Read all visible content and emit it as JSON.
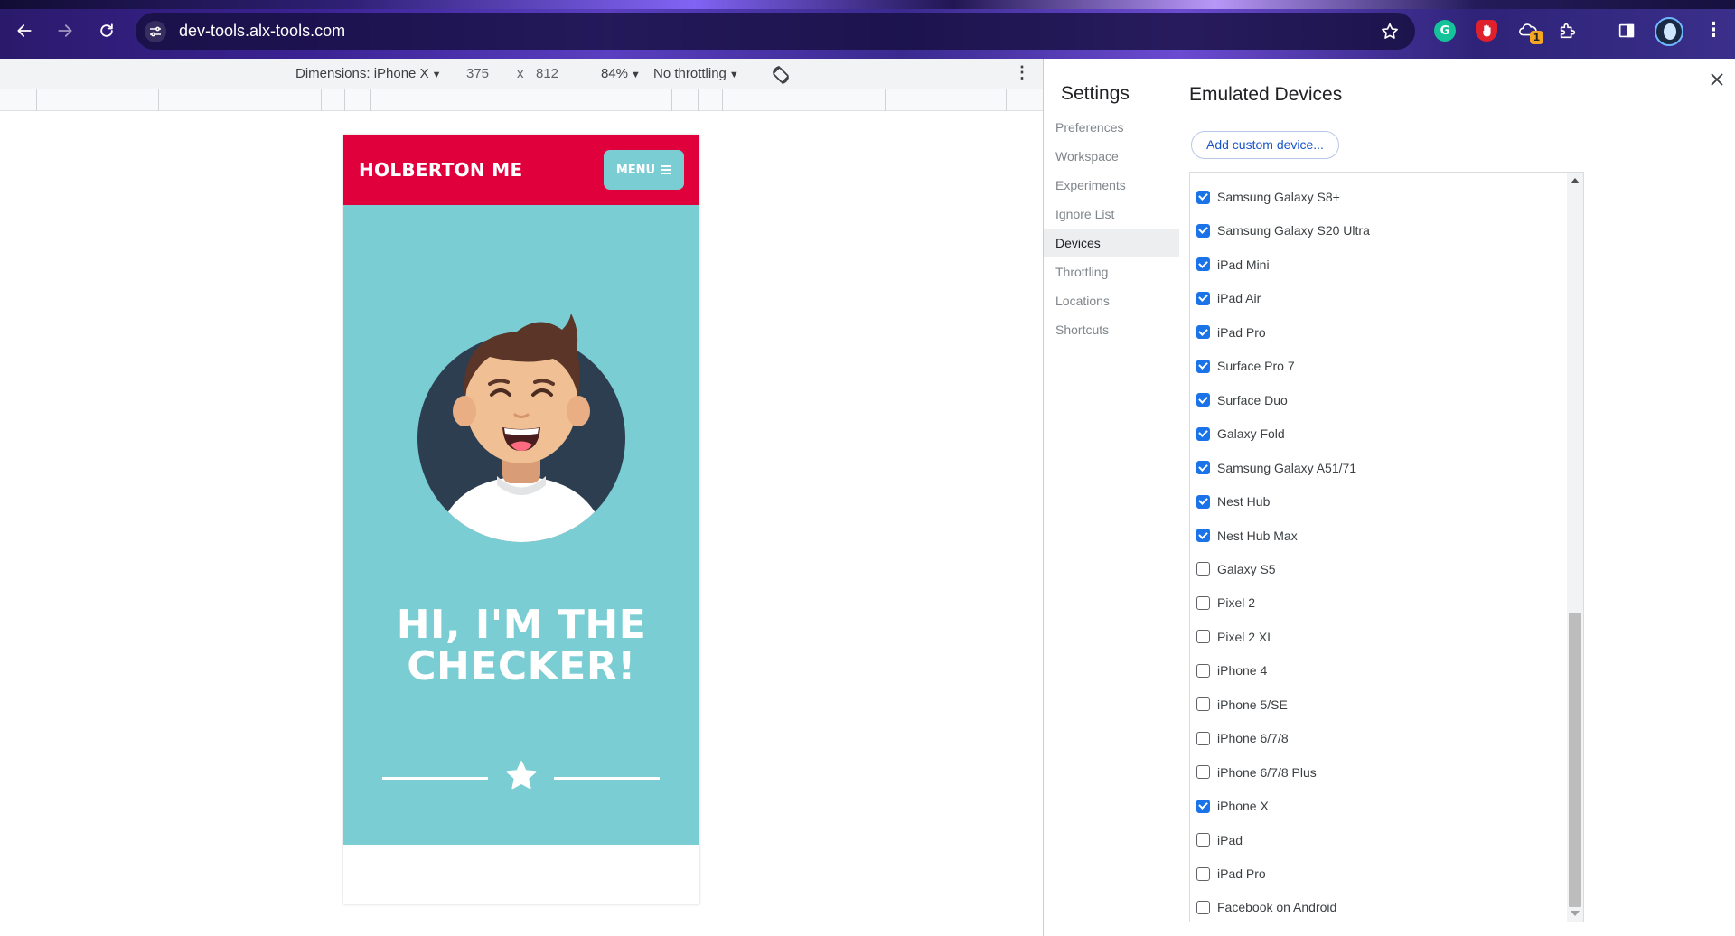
{
  "browser": {
    "url": "dev-tools.alx-tools.com",
    "extension_badge": "1"
  },
  "device_toolbar": {
    "dimensions_label": "Dimensions: iPhone X",
    "width": "375",
    "times": "x",
    "height": "812",
    "zoom": "84%",
    "throttling": "No throttling"
  },
  "site": {
    "logo": "HOLBERTON ME",
    "menu_label": "MENU",
    "hero_line1": "HI, I'M THE",
    "hero_line2": "CHECKER!",
    "colors": {
      "header": "#e0003c",
      "hero": "#7acdd3"
    }
  },
  "settings": {
    "title": "Settings",
    "nav": [
      {
        "label": "Preferences",
        "selected": false
      },
      {
        "label": "Workspace",
        "selected": false
      },
      {
        "label": "Experiments",
        "selected": false
      },
      {
        "label": "Ignore List",
        "selected": false
      },
      {
        "label": "Devices",
        "selected": true
      },
      {
        "label": "Throttling",
        "selected": false
      },
      {
        "label": "Locations",
        "selected": false
      },
      {
        "label": "Shortcuts",
        "selected": false
      }
    ],
    "content_title": "Emulated Devices",
    "add_device_label": "Add custom device...",
    "devices": [
      {
        "label": "Samsung Galaxy S8+",
        "checked": true
      },
      {
        "label": "Samsung Galaxy S20 Ultra",
        "checked": true
      },
      {
        "label": "iPad Mini",
        "checked": true
      },
      {
        "label": "iPad Air",
        "checked": true
      },
      {
        "label": "iPad Pro",
        "checked": true
      },
      {
        "label": "Surface Pro 7",
        "checked": true
      },
      {
        "label": "Surface Duo",
        "checked": true
      },
      {
        "label": "Galaxy Fold",
        "checked": true
      },
      {
        "label": "Samsung Galaxy A51/71",
        "checked": true
      },
      {
        "label": "Nest Hub",
        "checked": true
      },
      {
        "label": "Nest Hub Max",
        "checked": true
      },
      {
        "label": "Galaxy S5",
        "checked": false
      },
      {
        "label": "Pixel 2",
        "checked": false
      },
      {
        "label": "Pixel 2 XL",
        "checked": false
      },
      {
        "label": "iPhone 4",
        "checked": false
      },
      {
        "label": "iPhone 5/SE",
        "checked": false
      },
      {
        "label": "iPhone 6/7/8",
        "checked": false
      },
      {
        "label": "iPhone 6/7/8 Plus",
        "checked": false
      },
      {
        "label": "iPhone X",
        "checked": true
      },
      {
        "label": "iPad",
        "checked": false
      },
      {
        "label": "iPad Pro",
        "checked": false
      },
      {
        "label": "Facebook on Android",
        "checked": false
      }
    ]
  }
}
